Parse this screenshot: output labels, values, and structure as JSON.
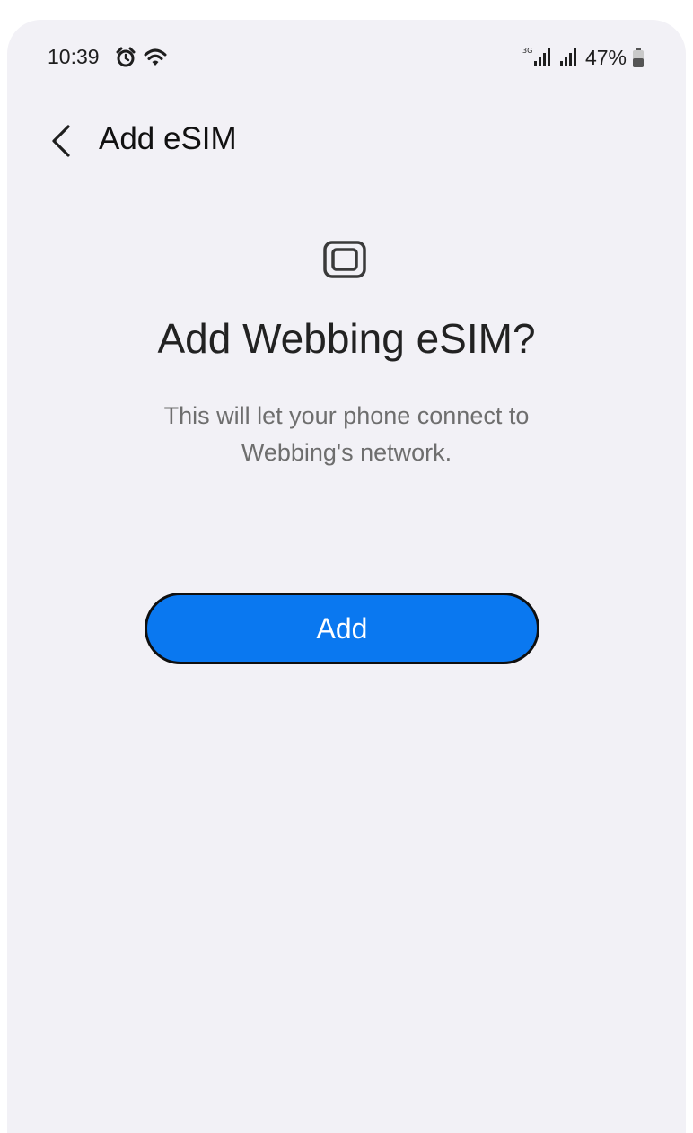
{
  "status_bar": {
    "time": "10:39",
    "battery_percent": "47%",
    "left_icons": [
      "alarm-icon",
      "wifi-icon"
    ],
    "right_icons": [
      "signal-3g-icon",
      "signal-icon",
      "battery-icon"
    ]
  },
  "header": {
    "back_icon": "chevron-left-icon",
    "title": "Add eSIM"
  },
  "dialog": {
    "icon": "sim-card-icon",
    "title": "Add Webbing eSIM?",
    "description": "This will let your phone connect to Webbing's network.",
    "add_label": "Add"
  },
  "colors": {
    "background": "#f2f1f6",
    "accent": "#0a78f0",
    "title_text": "#222222",
    "secondary_text": "#6e6e6e"
  }
}
